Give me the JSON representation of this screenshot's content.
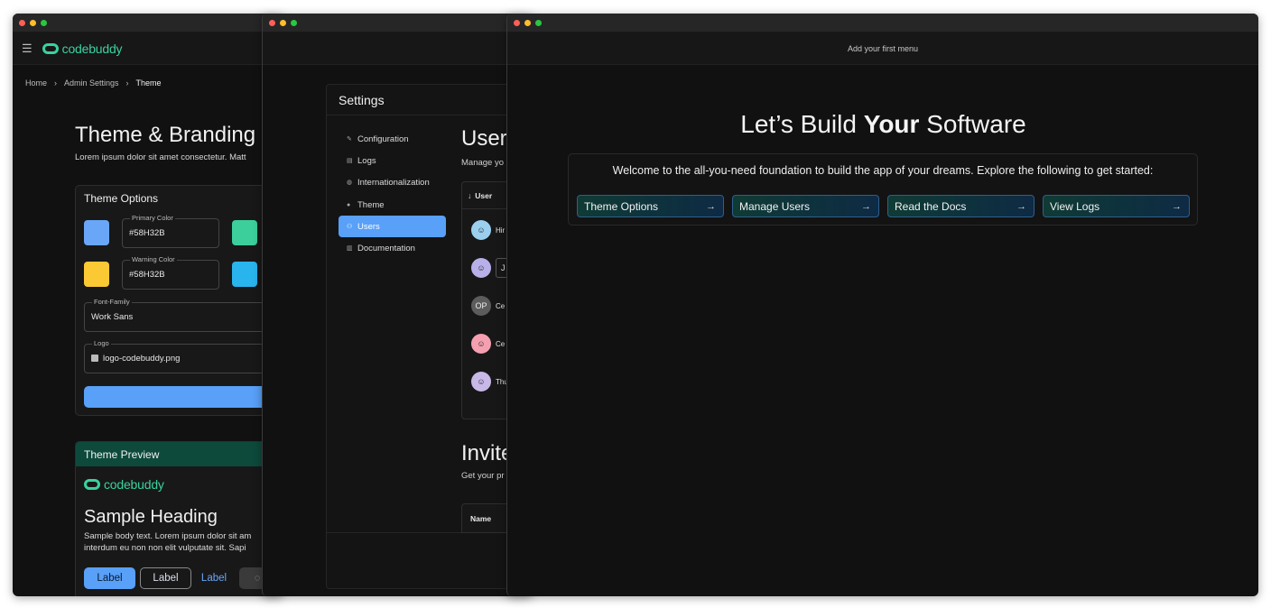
{
  "window1": {
    "app_logo": "codebuddy",
    "breadcrumb": [
      "Home",
      "Admin Settings",
      "Theme"
    ],
    "title": "Theme & Branding",
    "subtitle": "Lorem ipsum dolor sit amet consectetur. Matt",
    "options_panel": {
      "title": "Theme Options",
      "primary_color": {
        "label": "Primary Color",
        "value": "#58H32B",
        "swatch": "#6aa6f8"
      },
      "secondary_swatch": "#3ccf9b",
      "warning_color": {
        "label": "Warning Color",
        "value": "#58H32B",
        "swatch": "#fbc934"
      },
      "info_swatch": "#2ab4ee",
      "font_family": {
        "label": "Font-Family",
        "value": "Work Sans"
      },
      "logo": {
        "label": "Logo",
        "value": "logo-codebuddy.png"
      }
    },
    "preview_panel": {
      "title": "Theme Preview",
      "logo": "codebuddy",
      "heading": "Sample Heading",
      "body_line1": "Sample body text. Lorem ipsum dolor sit am",
      "body_line2": "interdum eu non non elit vulputate sit. Sapi",
      "buttons": [
        "Label",
        "Label",
        "Label"
      ]
    }
  },
  "window2": {
    "settings_title": "Settings",
    "nav": [
      {
        "label": "Configuration",
        "icon": "wrench-icon"
      },
      {
        "label": "Logs",
        "icon": "list-icon"
      },
      {
        "label": "Internationalization",
        "icon": "globe-icon"
      },
      {
        "label": "Theme",
        "icon": "palette-icon"
      },
      {
        "label": "Users",
        "icon": "users-icon",
        "active": true
      },
      {
        "label": "Documentation",
        "icon": "document-icon"
      }
    ],
    "users_title": "Users",
    "users_subtitle": "Manage yo",
    "users_table_header": "User",
    "users_rows": [
      "Hir",
      "J",
      "Ce",
      "Ce",
      "Thu"
    ],
    "initials_avatar": "OP",
    "invite_title": "Invite",
    "invite_subtitle": "Get your pr",
    "invite_table_header": "Name"
  },
  "window3": {
    "menu_placeholder": "Add your first menu",
    "hero_prefix": "Let’s Build ",
    "hero_bold": "Your",
    "hero_suffix": " Software",
    "welcome_text": "Welcome to the all-you-need foundation to build the app of your dreams. Explore the following to get started:",
    "actions": [
      "Theme Options",
      "Manage Users",
      "Read the Docs",
      "View Logs"
    ]
  }
}
